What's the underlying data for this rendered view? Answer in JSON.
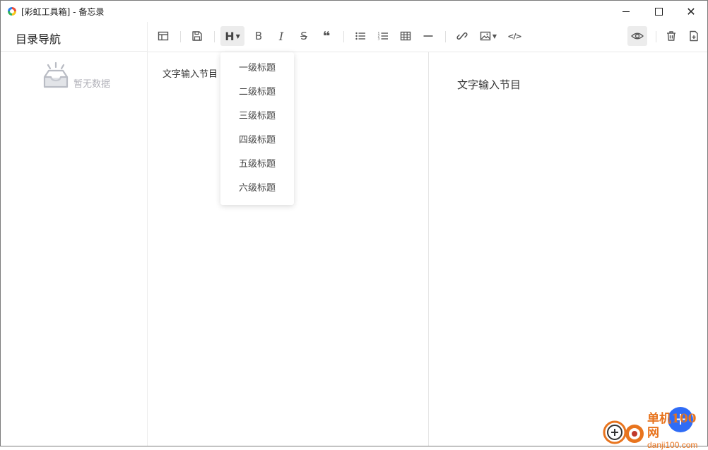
{
  "window": {
    "title": "[彩虹工具箱] - 备忘录",
    "controls": {
      "minimize": "minimize-icon",
      "maximize": "maximize-icon",
      "close": "✕"
    }
  },
  "sidebar": {
    "title": "目录导航",
    "empty_text": "暂无数据"
  },
  "toolbar": {
    "heading_label": "H",
    "bold_label": "B",
    "italic_label": "I",
    "strike_label": "S",
    "quote_label": "❝",
    "code_label": "</>"
  },
  "heading_menu": {
    "items": [
      "一级标题",
      "二级标题",
      "三级标题",
      "四级标题",
      "五级标题",
      "六级标题"
    ]
  },
  "editor": {
    "content": "文字输入节目"
  },
  "preview": {
    "content": "文字输入节目"
  },
  "fab": {
    "label": "+"
  },
  "watermark": {
    "cn": "单机100网",
    "url": "danji100.com"
  },
  "colors": {
    "fab": "#2f6cf6",
    "watermark": "#e8741e",
    "active_button": "#ececec"
  }
}
